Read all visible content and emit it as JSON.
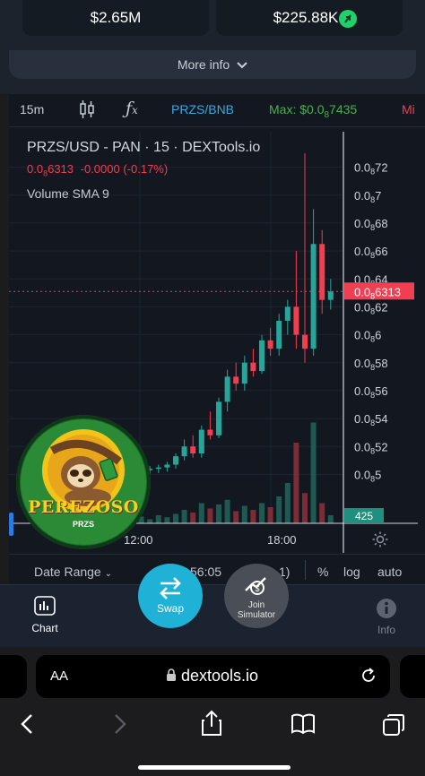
{
  "top_stats": {
    "left_value": "$2.65M",
    "right_value": "$225.88K"
  },
  "more_info_label": "More info",
  "toolbar": {
    "interval": "15m",
    "pair": "PRZS/BNB",
    "max_label": "Max: $0.0",
    "max_subscript": "8",
    "max_value_tail": "7435",
    "min_label": "Mi"
  },
  "legend": {
    "title": "PRZS/USD - PAN · 15 · DEXTools.io",
    "price_prefix": "0.0",
    "price_sub": "8",
    "price_tail": "6313",
    "change": "-0.0000 (-0.17%)",
    "volume_label": "Volume SMA 9"
  },
  "price_axis": {
    "prefix": "0.0",
    "sub": "8",
    "ticks": [
      "72",
      "7",
      "68",
      "66",
      "64",
      "62",
      "6",
      "58",
      "56",
      "54",
      "52",
      "5"
    ],
    "current_tail": "6313",
    "volume_value": "425"
  },
  "time_axis": [
    "12:00",
    "18:00"
  ],
  "range_bar": {
    "date_range": "Date Range",
    "clock": "56:05",
    "clock_tail": "1)",
    "percent": "%",
    "log": "log",
    "auto": "auto"
  },
  "nav": {
    "chart": "Chart",
    "swap": "Swap",
    "join": "Join",
    "simulator": "Simulator",
    "info": "Info"
  },
  "logo": {
    "name": "PEREZOSO",
    "ticker": "PRZS"
  },
  "browser": {
    "text_size": "AA",
    "url": "dextools.io"
  },
  "colors": {
    "up": "#26a69a",
    "down": "#ef3f50",
    "accent": "#1fb2d6",
    "max_green": "#4caf50"
  },
  "chart_data": {
    "type": "candlestick",
    "title": "PRZS/USD - PAN · 15 · DEXTools.io",
    "ylabel": "",
    "ylim": [
      4.9e-09,
      7.3e-09
    ],
    "candles": [
      {
        "o": 5e-09,
        "h": 5.02e-09,
        "l": 4.96e-09,
        "c": 5.01e-09
      },
      {
        "o": 5.01e-09,
        "h": 5.05e-09,
        "l": 4.98e-09,
        "c": 5.03e-09
      },
      {
        "o": 5.03e-09,
        "h": 5.06e-09,
        "l": 5e-09,
        "c": 5.04e-09
      },
      {
        "o": 5.04e-09,
        "h": 5.07e-09,
        "l": 5.01e-09,
        "c": 5.05e-09
      },
      {
        "o": 5.05e-09,
        "h": 5.09e-09,
        "l": 5.02e-09,
        "c": 5.07e-09
      },
      {
        "o": 5.07e-09,
        "h": 5.15e-09,
        "l": 5.04e-09,
        "c": 5.13e-09
      },
      {
        "o": 5.13e-09,
        "h": 5.25e-09,
        "l": 5.1e-09,
        "c": 5.2e-09
      },
      {
        "o": 5.2e-09,
        "h": 5.28e-09,
        "l": 5.12e-09,
        "c": 5.15e-09
      },
      {
        "o": 5.15e-09,
        "h": 5.35e-09,
        "l": 5.12e-09,
        "c": 5.32e-09
      },
      {
        "o": 5.32e-09,
        "h": 5.45e-09,
        "l": 5.25e-09,
        "c": 5.28e-09
      },
      {
        "o": 5.28e-09,
        "h": 5.55e-09,
        "l": 5.26e-09,
        "c": 5.52e-09
      },
      {
        "o": 5.52e-09,
        "h": 5.75e-09,
        "l": 5.45e-09,
        "c": 5.7e-09
      },
      {
        "o": 5.7e-09,
        "h": 5.8e-09,
        "l": 5.6e-09,
        "c": 5.65e-09
      },
      {
        "o": 5.65e-09,
        "h": 5.85e-09,
        "l": 5.6e-09,
        "c": 5.8e-09
      },
      {
        "o": 5.8e-09,
        "h": 5.9e-09,
        "l": 5.7e-09,
        "c": 5.74e-09
      },
      {
        "o": 5.74e-09,
        "h": 6e-09,
        "l": 5.72e-09,
        "c": 5.96e-09
      },
      {
        "o": 5.96e-09,
        "h": 6.05e-09,
        "l": 5.85e-09,
        "c": 5.9e-09
      },
      {
        "o": 5.9e-09,
        "h": 6.15e-09,
        "l": 5.85e-09,
        "c": 6.1e-09
      },
      {
        "o": 6.1e-09,
        "h": 6.25e-09,
        "l": 6e-09,
        "c": 6.2e-09
      },
      {
        "o": 6.2e-09,
        "h": 6.6e-09,
        "l": 5.9e-09,
        "c": 6e-09
      },
      {
        "o": 6e-09,
        "h": 7.3e-09,
        "l": 5.8e-09,
        "c": 5.9e-09
      },
      {
        "o": 5.9e-09,
        "h": 6.9e-09,
        "l": 5.85e-09,
        "c": 6.65e-09
      },
      {
        "o": 6.65e-09,
        "h": 6.75e-09,
        "l": 6.15e-09,
        "c": 6.25e-09
      },
      {
        "o": 6.25e-09,
        "h": 6.4e-09,
        "l": 6.18e-09,
        "c": 6.31e-09
      }
    ],
    "volumes": [
      8,
      10,
      6,
      12,
      9,
      14,
      20,
      16,
      30,
      22,
      28,
      35,
      18,
      26,
      20,
      30,
      24,
      40,
      60,
      120,
      45,
      150,
      30,
      12
    ],
    "volume_max": 160
  }
}
